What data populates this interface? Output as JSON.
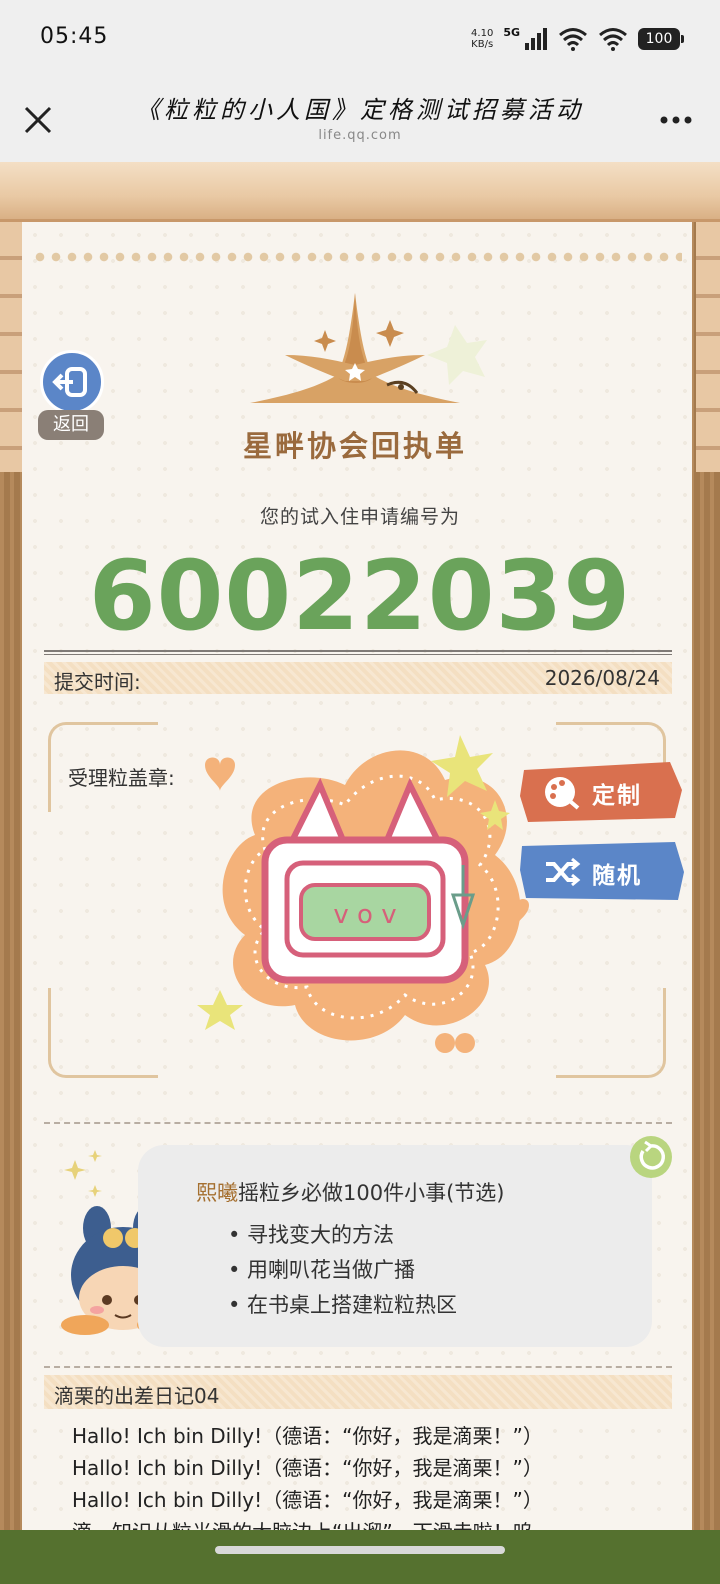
{
  "status_bar": {
    "time": "05:45",
    "net_speed_value": "4.10",
    "net_speed_unit": "KB/s",
    "signal_label": "5G",
    "battery": "100"
  },
  "header": {
    "title": "《粒粒的小人国》定格测试招募活动",
    "url": "life.qq.com",
    "close_icon": "close-icon",
    "more_icon": "more-icon"
  },
  "page": {
    "back_label": "返回",
    "logo_title": "星畔协会回执单",
    "apply_label": "您的试入住申请编号为",
    "apply_number": "60022039",
    "submit_time_label": "提交时间:",
    "submit_time_value": "2026/08/24",
    "stamp_label": "受理粒盖章:",
    "stamp_face": "v o v",
    "customize_label": "定制",
    "random_label": "随机",
    "todo": {
      "name": "熙曦",
      "title_rest": "摇粒乡必做100件小事(节选)",
      "items": [
        "• 寻找变大的方法",
        "• 用喇叭花当做广播",
        "• 在书桌上搭建粒粒热区"
      ]
    },
    "diary": {
      "title": "滴栗的出差日记04",
      "lines": [
        "Hallo! Ich bin Dilly!（德语：“你好，我是滴栗！”）",
        "Hallo! Ich bin Dilly!（德语：“你好，我是滴栗！”）",
        "Hallo! Ich bin Dilly!（德语：“你好，我是滴栗！”）",
        "滴。知识从粒光滑的大脑边上“出溜”一下滑走啦！呜"
      ]
    }
  },
  "colors": {
    "accent_green": "#6aa35b",
    "logo_brown": "#9a6a3d",
    "customize_bg": "#d9704f",
    "random_bg": "#5b86c8",
    "bottom_bar": "#55712f"
  }
}
